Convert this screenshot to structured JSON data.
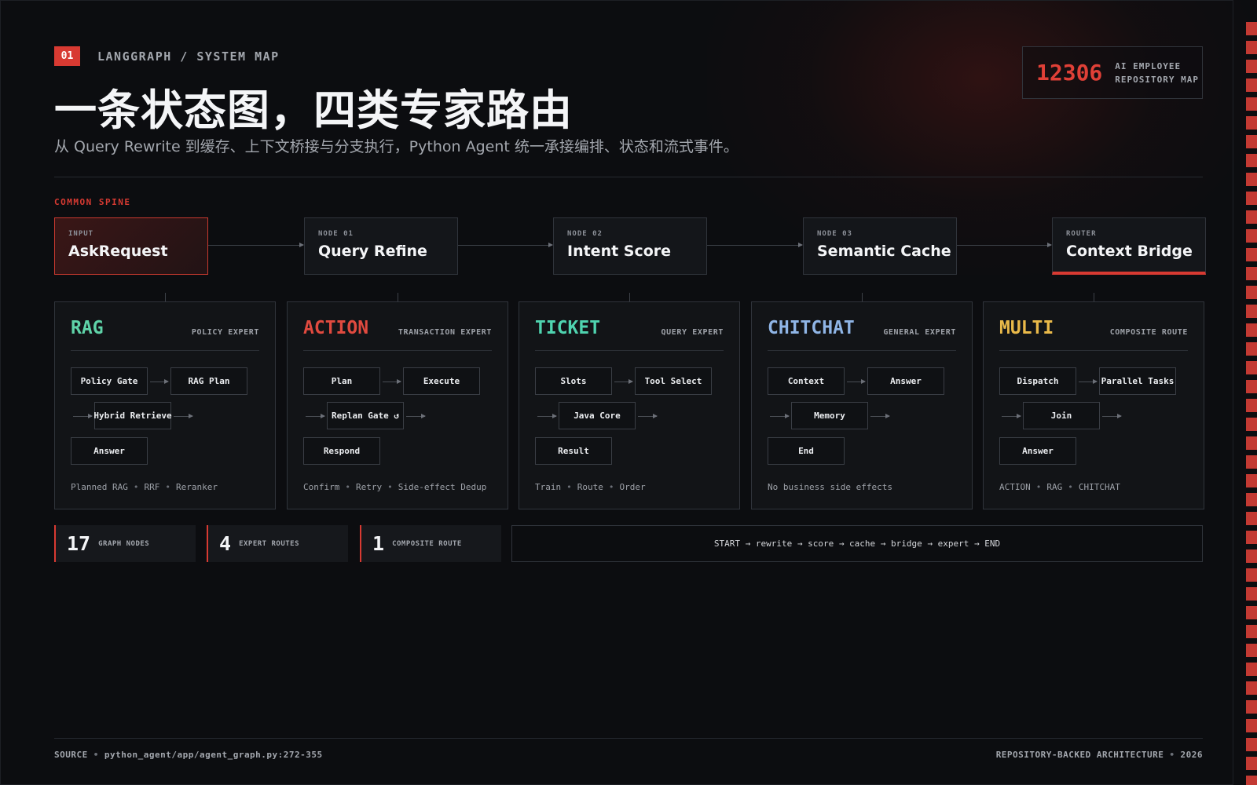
{
  "header": {
    "badge": "01",
    "eyebrow": "LANGGRAPH / SYSTEM MAP",
    "title": "一条状态图，四类专家路由",
    "subtitle": "从 Query Rewrite 到缓存、上下文桥接与分支执行，Python Agent 统一承接编排、状态和流式事件。"
  },
  "id_box": {
    "number": "12306",
    "label_line1": "AI EMPLOYEE",
    "label_line2": "REPOSITORY MAP"
  },
  "spine": {
    "label": "COMMON SPINE",
    "nodes": [
      {
        "sub": "INPUT",
        "title": "AskRequest"
      },
      {
        "sub": "NODE 01",
        "title": "Query Refine"
      },
      {
        "sub": "NODE 02",
        "title": "Intent Score"
      },
      {
        "sub": "NODE 03",
        "title": "Semantic Cache"
      },
      {
        "sub": "ROUTER",
        "title": "Context Bridge"
      }
    ]
  },
  "experts": [
    {
      "name": "RAG",
      "tag": "POLICY EXPERT",
      "color": "#5fd3a8",
      "steps": [
        "Policy Gate",
        "RAG Plan",
        "Hybrid Retrieve",
        "Answer"
      ],
      "foot": [
        "Planned RAG",
        "RRF",
        "Reranker"
      ]
    },
    {
      "name": "ACTION",
      "tag": "TRANSACTION EXPERT",
      "color": "#e04a3f",
      "steps": [
        "Plan",
        "Execute",
        "Replan Gate ↺",
        "Respond"
      ],
      "foot": [
        "Confirm",
        "Retry",
        "Side-effect Dedup"
      ]
    },
    {
      "name": "TICKET",
      "tag": "QUERY EXPERT",
      "color": "#4fd4b0",
      "steps": [
        "Slots",
        "Tool Select",
        "Java Core",
        "Result"
      ],
      "foot": [
        "Train",
        "Route",
        "Order"
      ]
    },
    {
      "name": "CHITCHAT",
      "tag": "GENERAL EXPERT",
      "color": "#8fb5e6",
      "steps": [
        "Context",
        "Answer",
        "Memory",
        "End"
      ],
      "foot": [
        "No business side effects"
      ]
    },
    {
      "name": "MULTI",
      "tag": "COMPOSITE ROUTE",
      "color": "#e9b949",
      "steps": [
        "Dispatch",
        "Parallel Tasks",
        "Join",
        "Answer"
      ],
      "foot": [
        "ACTION",
        "RAG",
        "CHITCHAT"
      ]
    }
  ],
  "stats": [
    {
      "value": "17",
      "label": "GRAPH NODES"
    },
    {
      "value": "4",
      "label": "EXPERT ROUTES"
    },
    {
      "value": "1",
      "label": "COMPOSITE ROUTE"
    }
  ],
  "flow": "START → rewrite → score → cache → bridge → expert → END",
  "footer": {
    "source_label": "SOURCE",
    "source_path": "python_agent/app/agent_graph.py:272-355",
    "right_label": "REPOSITORY-BACKED ARCHITECTURE",
    "year": "2026"
  },
  "colors": {
    "accent": "#d83a32",
    "background": "#0c0d10"
  }
}
